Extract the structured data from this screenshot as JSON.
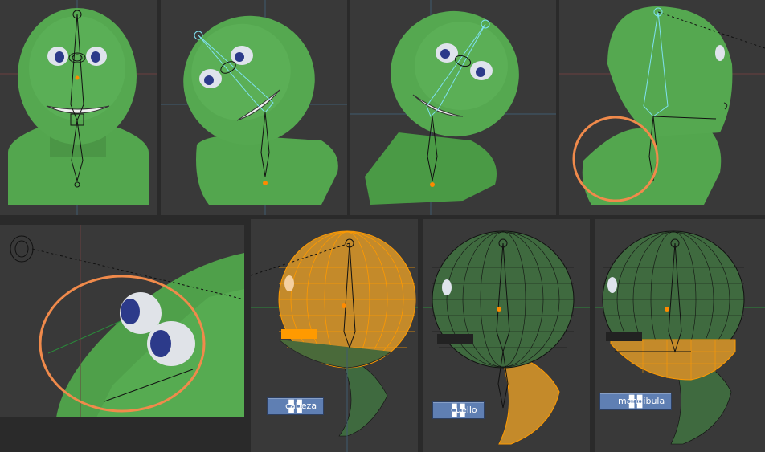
{
  "panels": [
    {
      "view": "front"
    },
    {
      "view": "tilted-left"
    },
    {
      "view": "tilted-right"
    },
    {
      "view": "side",
      "highlight": "neck-deformation"
    },
    {
      "view": "eyes-closeup",
      "highlight": "eyes"
    },
    {
      "view": "wireframe",
      "vertex_group": "cabeza"
    },
    {
      "view": "wireframe",
      "vertex_group": "cuello"
    },
    {
      "view": "wireframe",
      "vertex_group": "mandibula"
    }
  ],
  "vertex_groups": {
    "cabeza": "cabeza",
    "cuello": "cuello",
    "mandibula": "mandibula"
  },
  "colors": {
    "skin": "#4fa04a",
    "background": "#393939",
    "selection": "#ff9a00",
    "highlight_circle": "#f08a4b",
    "bone_selected": "#7fe0f0",
    "label_bg": "#5f7fb3"
  },
  "icons": {
    "vertex_group": "vertex-group-icon"
  }
}
